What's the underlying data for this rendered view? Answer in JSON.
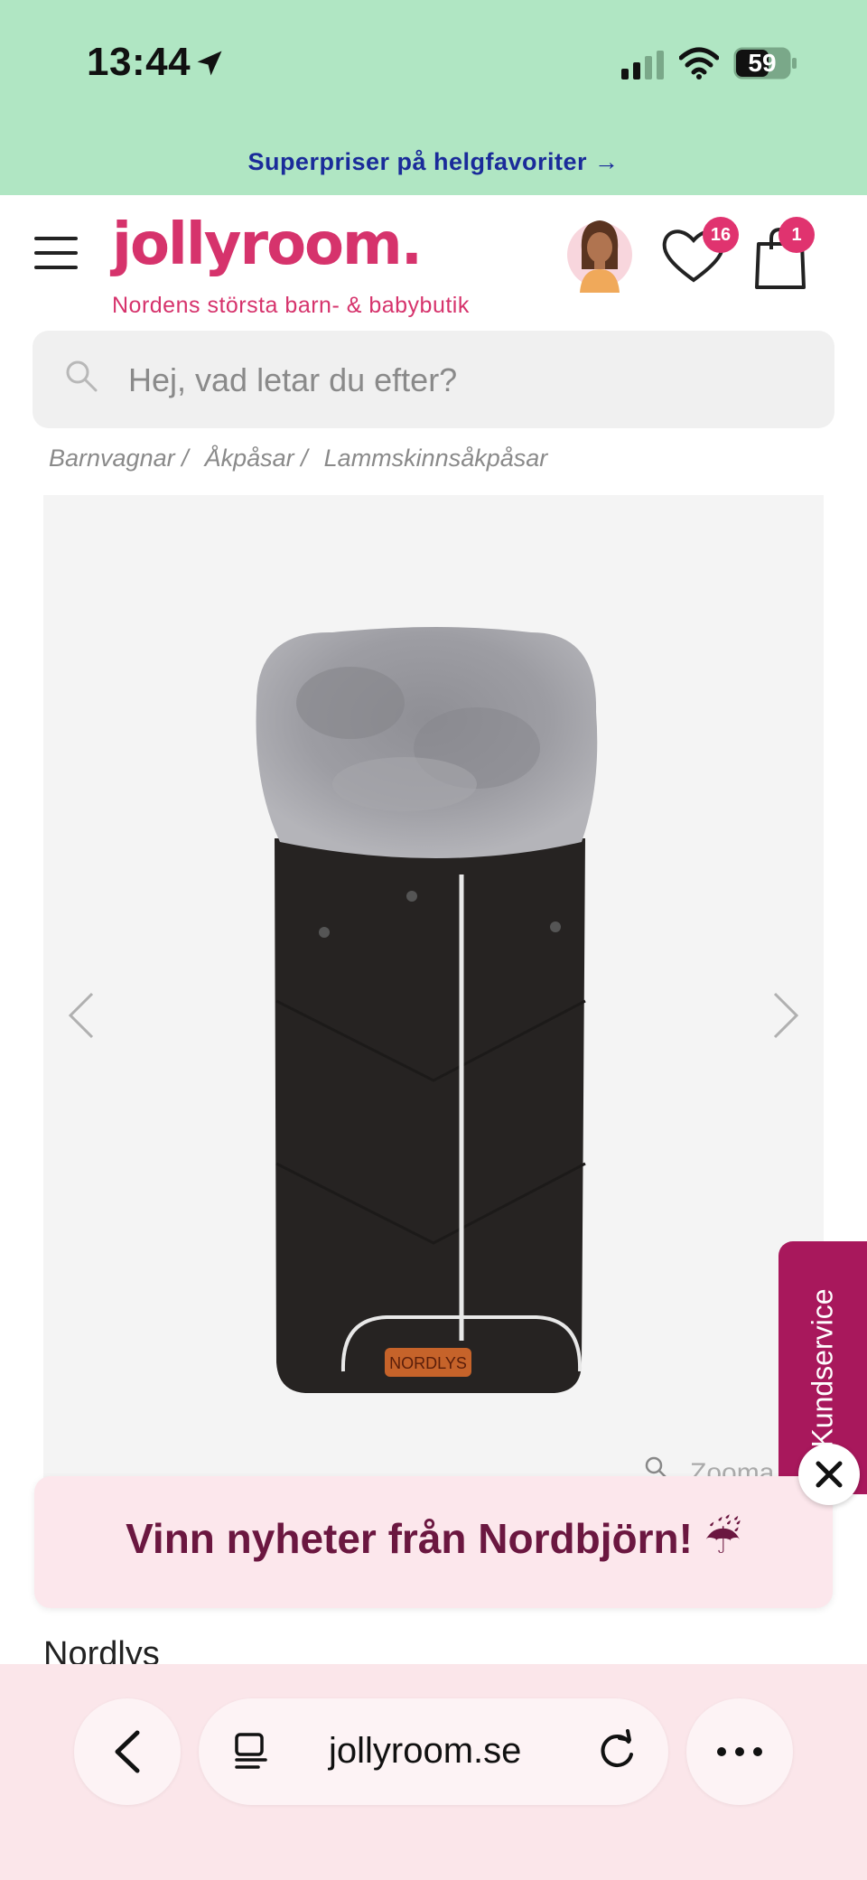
{
  "status_bar": {
    "time": "13:44",
    "battery": "59"
  },
  "promo": {
    "text": "Superpriser på helgfavoriter →"
  },
  "header": {
    "logo": "jollyroom.",
    "tagline": "Nordens största barn- & babybutik",
    "wishlist_count": "16",
    "cart_count": "1"
  },
  "search": {
    "placeholder": "Hej, vad letar du efter?"
  },
  "breadcrumb": [
    "Barnvagnar /",
    "Åkpåsar /",
    "Lammskinnsåkpåsar"
  ],
  "gallery": {
    "badge_text": "NORDLYS",
    "zoom_label": "Zooma"
  },
  "kundservice": {
    "label": "Kundservice"
  },
  "popup": {
    "text": "Vinn nyheter från Nordbjörn! ☔"
  },
  "product": {
    "title": "Nordlys"
  },
  "browser": {
    "url": "jollyroom.se"
  },
  "colors": {
    "brand": "#d6336c",
    "status_bg": "#b0e6c3",
    "kundservice": "#a8185c",
    "popup_text": "#6b1740"
  }
}
